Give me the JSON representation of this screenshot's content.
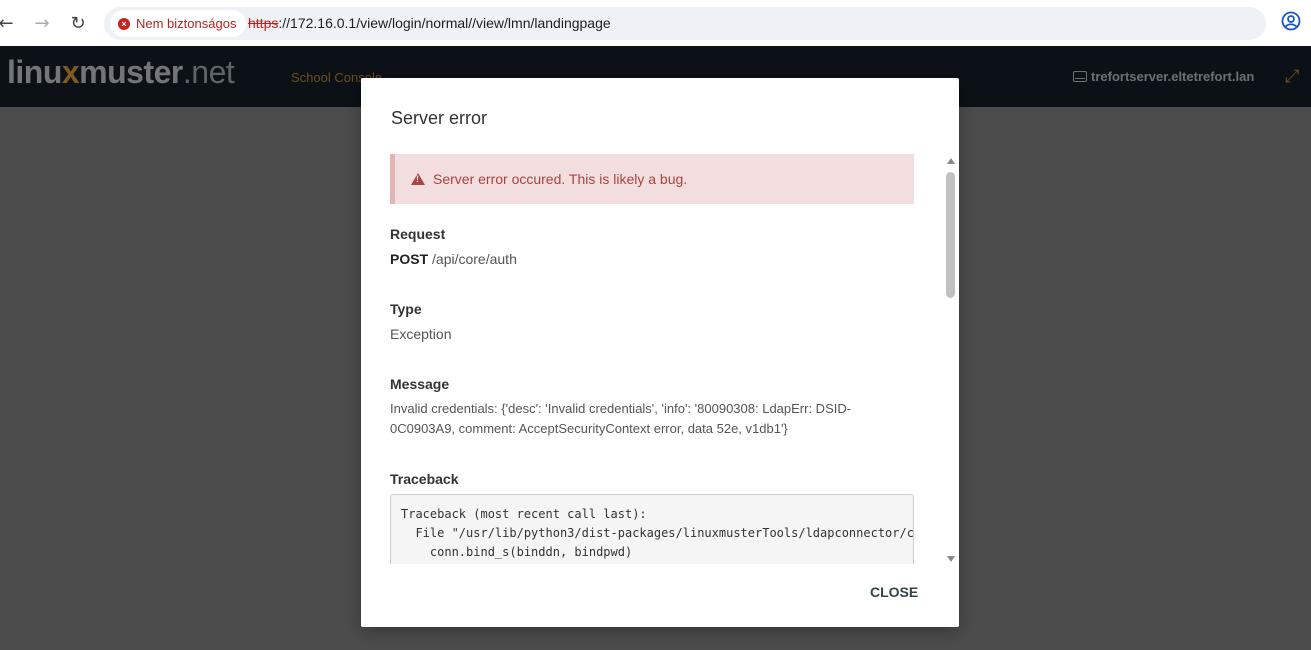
{
  "browser": {
    "security_label": "Nem biztonságos",
    "url_scheme": "https",
    "url_rest": "://172.16.0.1/view/login/normal//view/lmn/landingpage"
  },
  "app": {
    "logo_part1": "linu",
    "logo_x": "x",
    "logo_part2": "muster",
    "logo_net": ".net",
    "nav_school": "School Console",
    "server_name": "trefortserver.eltetrefort.lan"
  },
  "modal": {
    "title": "Server error",
    "alert_text": "Server error occured. This is likely a bug.",
    "request_label": "Request",
    "request_method": "POST",
    "request_path": " /api/core/auth",
    "type_label": "Type",
    "type_value": "Exception",
    "message_label": "Message",
    "message_value": "Invalid credentials: {'desc': 'Invalid credentials', 'info': '80090308: LdapErr: DSID-0C0903A9, comment: AcceptSecurityContext error, data 52e, v1db1'}",
    "traceback_label": "Traceback",
    "traceback_text": "Traceback (most recent call last):\n  File \"/usr/lib/python3/dist-packages/linuxmusterTools/ldapconnector/co\n    conn.bind_s(binddn, bindpwd)",
    "close_label": "CLOSE"
  },
  "icons": {
    "back": "arrow-left-icon",
    "forward": "arrow-right-icon",
    "reload": "reload-icon",
    "star": "star-icon",
    "profile": "profile-icon",
    "warning": "warning-icon",
    "server": "server-icon",
    "expand": "expand-icon"
  },
  "colors": {
    "header_bg": "#152028",
    "accent": "#c98a2f",
    "alert_bg": "#f2dede",
    "alert_text": "#a94442"
  }
}
